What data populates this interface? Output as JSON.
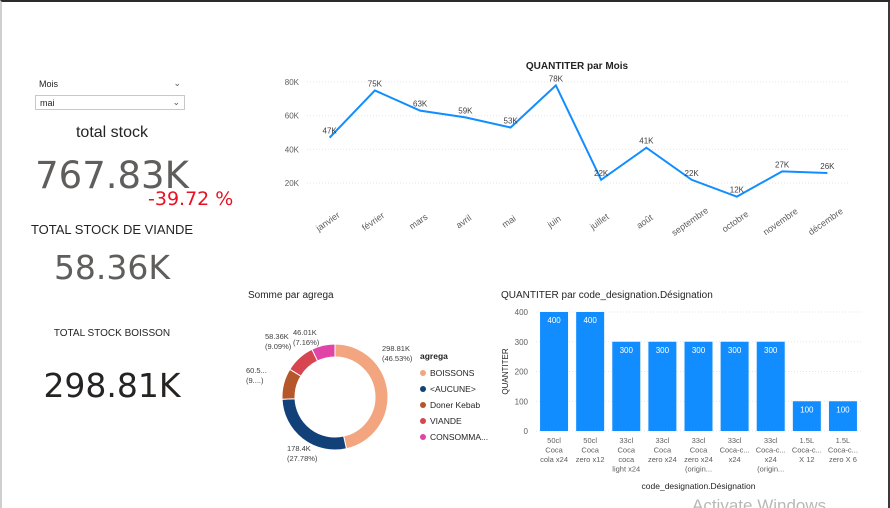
{
  "slicer": {
    "label": "Mois",
    "selected": "mai"
  },
  "cards": {
    "total_stock": {
      "title": "total stock",
      "value": "767.83K",
      "delta": "-39.72 %"
    },
    "viande": {
      "title": "TOTAL STOCK DE VIANDE",
      "value": "58.36K"
    },
    "boisson": {
      "title": "TOTAL STOCK BOISSON",
      "value": "298.81K"
    }
  },
  "colors": {
    "primary": "#118dff",
    "delta_negative": "#e81123"
  },
  "chart_data": [
    {
      "type": "line",
      "title": "QUANTITER par Mois",
      "categories": [
        "janvier",
        "février",
        "mars",
        "avril",
        "mai",
        "juin",
        "juillet",
        "août",
        "septembre",
        "octobre",
        "novembre",
        "décembre"
      ],
      "values": [
        47,
        75,
        63,
        59,
        53,
        78,
        22,
        41,
        22,
        12,
        27,
        26
      ],
      "data_labels": [
        "47K",
        "75K",
        "63K",
        "59K",
        "53K",
        "78K",
        "22K",
        "41K",
        "22K",
        "12K",
        "27K",
        "26K"
      ],
      "ylim": [
        0,
        80
      ],
      "yticks": [
        20,
        40,
        60,
        80
      ],
      "ytick_labels": [
        "20K",
        "40K",
        "60K",
        "80K"
      ]
    },
    {
      "type": "pie",
      "title": "Somme par agrega",
      "legend_title": "agrega",
      "slices": [
        {
          "name": "BOISSONS",
          "value": 298.81,
          "label": "298.81K",
          "pct": "(46.53%)",
          "color": "#f2a57e"
        },
        {
          "name": "<AUCUNE>",
          "value": 178.4,
          "label": "178.4K",
          "pct": "(27.78%)",
          "color": "#12417a"
        },
        {
          "name": "Doner Kebab",
          "value": 60.5,
          "label": "60.5...",
          "pct": "(9....)",
          "color": "#b5572a"
        },
        {
          "name": "VIANDE",
          "value": 58.36,
          "label": "58.36K",
          "pct": "(9.09%)",
          "color": "#d64550"
        },
        {
          "name": "CONSOMMA...",
          "value": 46.01,
          "label": "46.01K",
          "pct": "(7.16%)",
          "color": "#e044a7"
        }
      ]
    },
    {
      "type": "bar",
      "title": "QUANTITER par code_designation.Désignation",
      "xlabel": "code_designation.Désignation",
      "ylabel": "QUANTITER",
      "ylim": [
        0,
        400
      ],
      "yticks": [
        0,
        100,
        200,
        300,
        400
      ],
      "categories": [
        [
          "50cl",
          "Coca",
          "cola x24"
        ],
        [
          "50cl",
          "Coca",
          "zero x12"
        ],
        [
          "33cl",
          "Coca",
          "coca",
          "light x24"
        ],
        [
          "33cl",
          "Coca",
          "zero x24"
        ],
        [
          "33cl",
          "Coca",
          "zero x24",
          "(origin..."
        ],
        [
          "33cl",
          "Coca-c...",
          "x24"
        ],
        [
          "33cl",
          "Coca-c...",
          "x24",
          "(origin..."
        ],
        [
          "1.5L",
          "Coca-c...",
          "X 12"
        ],
        [
          "1.5L",
          "Coca-c...",
          "zero X 6"
        ]
      ],
      "values": [
        400,
        400,
        300,
        300,
        300,
        300,
        300,
        100,
        100
      ]
    }
  ],
  "watermark": "Activate Windows"
}
